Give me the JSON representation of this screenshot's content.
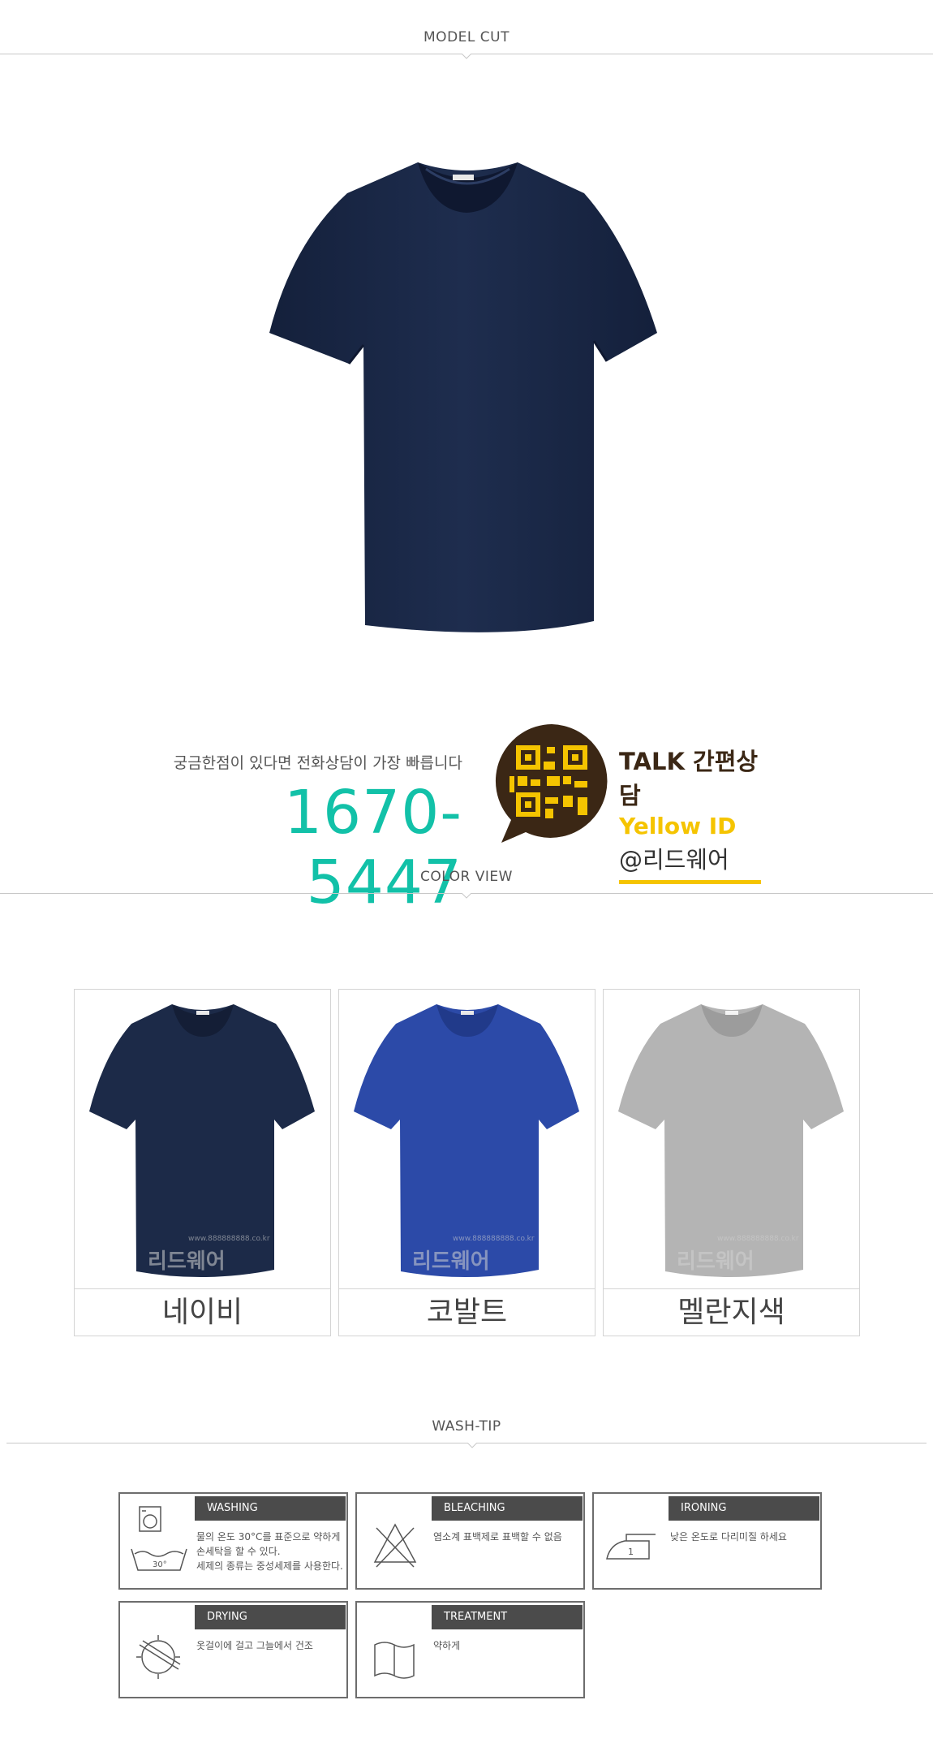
{
  "sections": {
    "model_cut": "MODEL CUT",
    "color_view": "COLOR VIEW",
    "wash_tip": "WASH-TIP"
  },
  "contact": {
    "caption": "궁금한점이 있다면 전화상담이 가장 빠릅니다",
    "phone": "1670-5447",
    "talk_line1": "TALK 간편상담",
    "talk_line2": "Yellow ID",
    "talk_line3": "@리드웨어"
  },
  "colors": [
    {
      "name": "네이비",
      "hex": "#1c2a48",
      "hex_dark": "#141e36"
    },
    {
      "name": "코발트",
      "hex": "#2c4aa8",
      "hex_dark": "#213a8a"
    },
    {
      "name": "멜란지색",
      "hex": "#b4b4b4",
      "hex_dark": "#9c9c9c"
    }
  ],
  "watermark": {
    "brand": "리드웨어",
    "url": "www.888888888.co.kr"
  },
  "wash_tips": [
    {
      "title": "WASHING",
      "icon": "washing-icon",
      "text": "물의 온도 30°C를 표준으로 약하게 손세탁을 할 수 있다.\n세제의 종류는 중성세제를 사용한다.",
      "temp": "30°"
    },
    {
      "title": "BLEACHING",
      "icon": "no-bleach-icon",
      "text": "염소계 표백제로 표백할 수 없음"
    },
    {
      "title": "IRONING",
      "icon": "iron-icon",
      "text": "낮은 온도로 다리미질 하세요",
      "level": "1"
    },
    {
      "title": "DRYING",
      "icon": "shade-dry-icon",
      "text": "옷걸이에 걸고 그늘에서 건조"
    },
    {
      "title": "TREATMENT",
      "icon": "treatment-icon",
      "text": "약하게"
    }
  ],
  "product_color": "#1c2a48"
}
